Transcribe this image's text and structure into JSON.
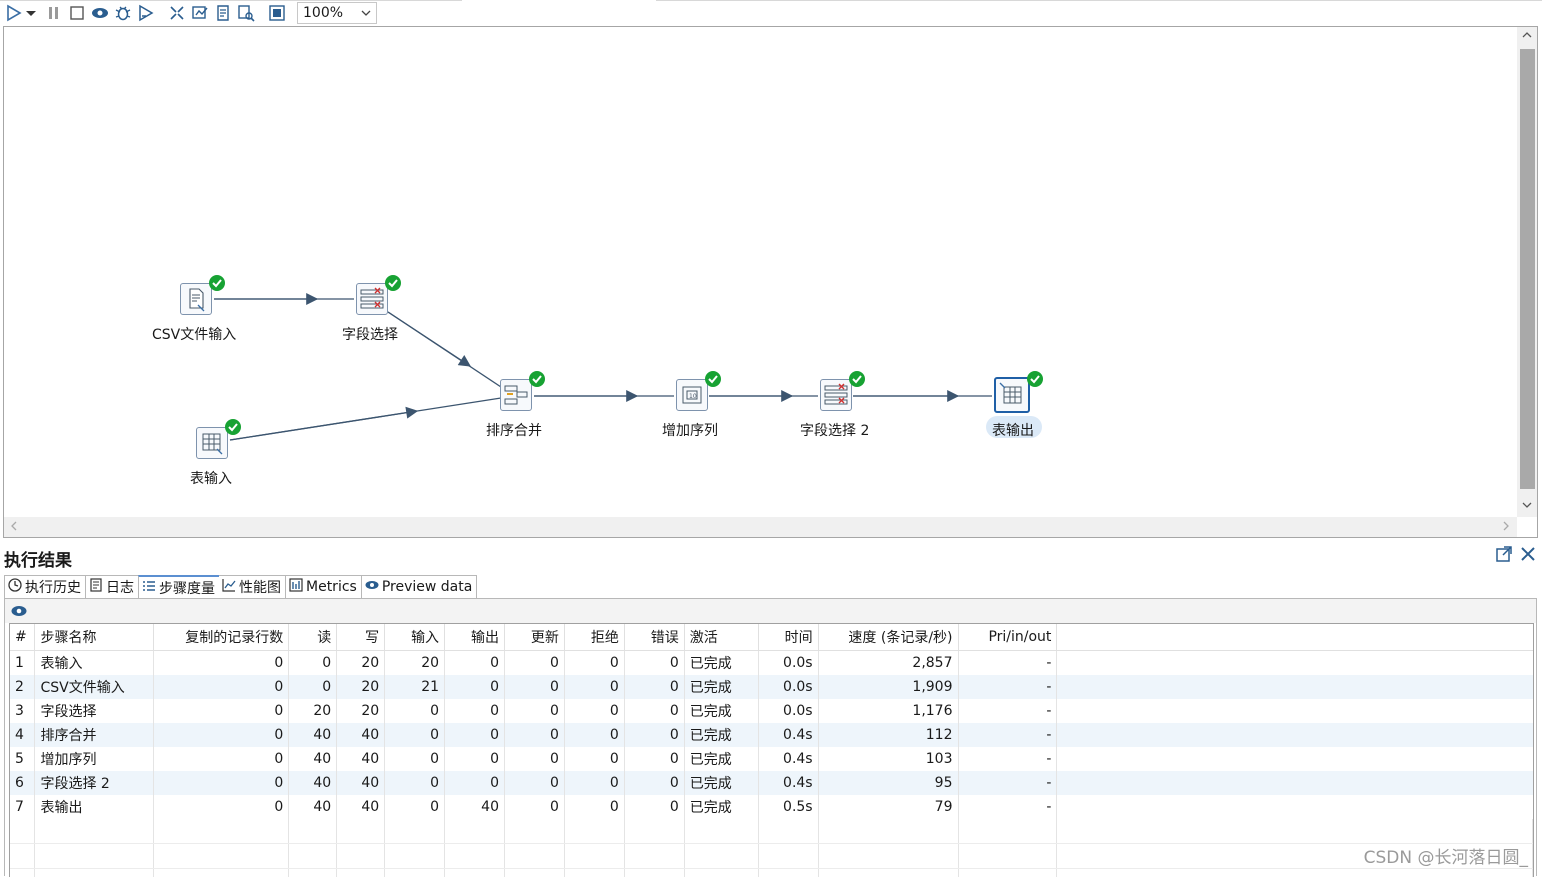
{
  "toolbar": {
    "zoom_value": "100%",
    "buttons": [
      "run-icon",
      "run-options-icon",
      "pause-icon",
      "stop-icon",
      "preview-icon",
      "debug-icon",
      "replay-icon",
      "check-icon",
      "analyze-icon",
      "sql-icon",
      "explore-icon",
      "fit-icon"
    ]
  },
  "canvas": {
    "steps": [
      {
        "id": "csv",
        "label": "CSV文件输入",
        "icon": "csv-file-icon"
      },
      {
        "id": "select1",
        "label": "字段选择",
        "icon": "select-values-icon"
      },
      {
        "id": "tablein",
        "label": "表输入",
        "icon": "table-input-icon"
      },
      {
        "id": "merge",
        "label": "排序合并",
        "icon": "sorted-merge-icon"
      },
      {
        "id": "seq",
        "label": "增加序列",
        "icon": "add-sequence-icon"
      },
      {
        "id": "select2",
        "label": "字段选择 2",
        "icon": "select-values-icon"
      },
      {
        "id": "tableout",
        "label": "表输出",
        "icon": "table-output-icon"
      }
    ]
  },
  "results": {
    "title": "执行结果",
    "tabs": [
      {
        "label": "执行历史",
        "icon": "history-icon"
      },
      {
        "label": "日志",
        "icon": "log-icon"
      },
      {
        "label": "步骤度量",
        "icon": "metrics-list-icon"
      },
      {
        "label": "性能图",
        "icon": "chart-icon"
      },
      {
        "label": "Metrics",
        "icon": "metrics-icon"
      },
      {
        "label": "Preview data",
        "icon": "eye-icon"
      }
    ],
    "columns": [
      "#",
      "步骤名称",
      "复制的记录行数",
      "读",
      "写",
      "输入",
      "输出",
      "更新",
      "拒绝",
      "错误",
      "激活",
      "时间",
      "速度 (条记录/秒)",
      "Pri/in/out"
    ],
    "rows": [
      [
        "1",
        "表输入",
        "0",
        "0",
        "20",
        "20",
        "0",
        "0",
        "0",
        "0",
        "已完成",
        "0.0s",
        "2,857",
        "-"
      ],
      [
        "2",
        "CSV文件输入",
        "0",
        "0",
        "20",
        "21",
        "0",
        "0",
        "0",
        "0",
        "已完成",
        "0.0s",
        "1,909",
        "-"
      ],
      [
        "3",
        "字段选择",
        "0",
        "20",
        "20",
        "0",
        "0",
        "0",
        "0",
        "0",
        "已完成",
        "0.0s",
        "1,176",
        "-"
      ],
      [
        "4",
        "排序合并",
        "0",
        "40",
        "40",
        "0",
        "0",
        "0",
        "0",
        "0",
        "已完成",
        "0.4s",
        "112",
        "-"
      ],
      [
        "5",
        "增加序列",
        "0",
        "40",
        "40",
        "0",
        "0",
        "0",
        "0",
        "0",
        "已完成",
        "0.4s",
        "103",
        "-"
      ],
      [
        "6",
        "字段选择 2",
        "0",
        "40",
        "40",
        "0",
        "0",
        "0",
        "0",
        "0",
        "已完成",
        "0.4s",
        "95",
        "-"
      ],
      [
        "7",
        "表输出",
        "0",
        "40",
        "40",
        "0",
        "40",
        "0",
        "0",
        "0",
        "已完成",
        "0.5s",
        "79",
        "-"
      ]
    ]
  },
  "watermark": "CSDN @长河落日圆_"
}
